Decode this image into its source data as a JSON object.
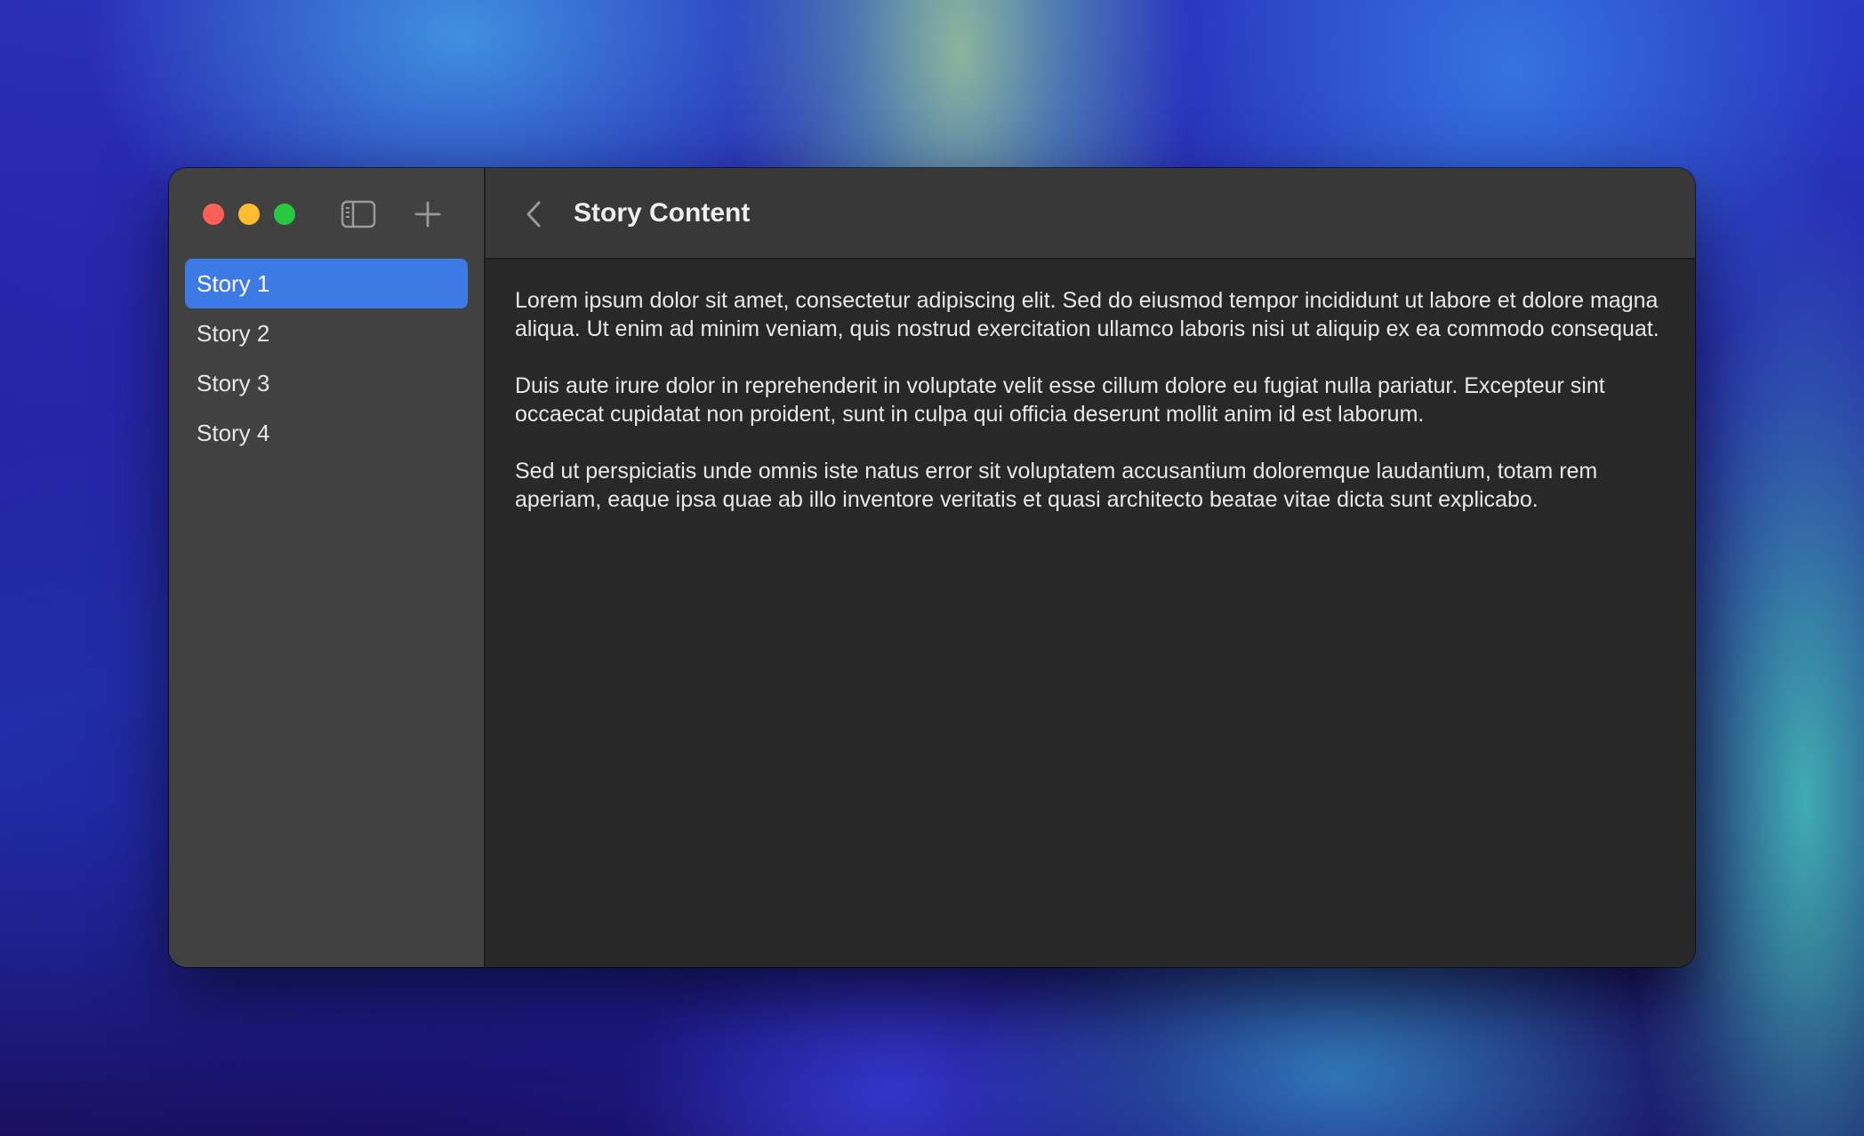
{
  "window": {
    "title": "Story Content"
  },
  "toolbar": {
    "sidebar_toggle_icon": "sidebar-left-icon",
    "add_icon": "plus-icon",
    "back_icon": "chevron-left-icon"
  },
  "sidebar": {
    "items": [
      {
        "label": "Story 1",
        "selected": true
      },
      {
        "label": "Story 2",
        "selected": false
      },
      {
        "label": "Story 3",
        "selected": false
      },
      {
        "label": "Story 4",
        "selected": false
      }
    ]
  },
  "content": {
    "paragraphs": [
      "Lorem ipsum dolor sit amet, consectetur adipiscing elit. Sed do eiusmod tempor incididunt ut labore et dolore magna aliqua. Ut enim ad minim veniam, quis nostrud exercitation ullamco laboris nisi ut aliquip ex ea commodo consequat.",
      "Duis aute irure dolor in reprehenderit in voluptate velit esse cillum dolore eu fugiat nulla pariatur. Excepteur sint occaecat cupidatat non proident, sunt in culpa qui officia deserunt mollit anim id est laborum.",
      "Sed ut perspiciatis unde omnis iste natus error sit voluptatem accusantium doloremque laudantium, totam rem aperiam, eaque ipsa quae ab illo inventore veritatis et quasi architecto beatae vitae dicta sunt explicabo."
    ]
  },
  "colors": {
    "accent": "#3d7ae5",
    "close": "#fe5f57",
    "minimize": "#febc2e",
    "zoom": "#28c840",
    "sidebar_bg": "#414141",
    "content_bg": "#282828",
    "header_bg": "#383838"
  }
}
